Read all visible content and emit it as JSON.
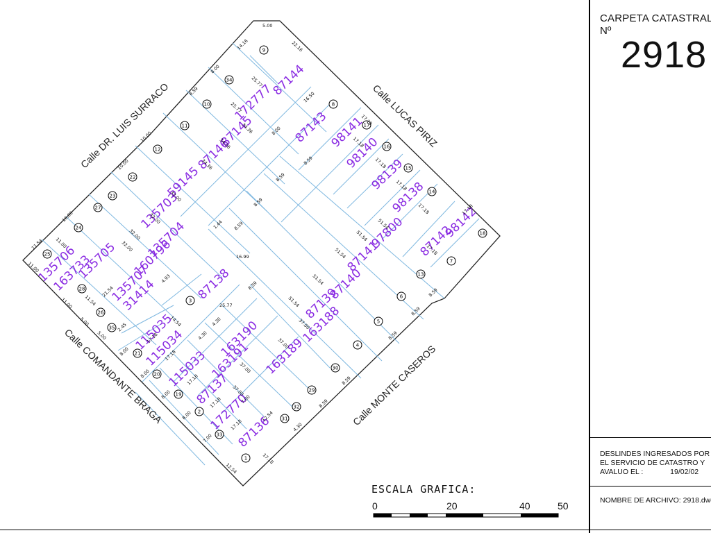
{
  "sidebar": {
    "carpeta_label": "CARPETA CATASTRAL",
    "no_label": "Nº",
    "carpeta_number": "2918",
    "deslindes_line1": "DESLINDES INGRESADOS POR",
    "deslindes_line2": "EL SERVICIO DE CATASTRO Y",
    "avaluo_label": "AVALUO EL :",
    "avaluo_date": "19/02/02",
    "archivo_label": "NOMBRE DE ARCHIVO: 2918.dwg"
  },
  "streets": {
    "north_west": "Calle DR. LUIS SURRACO",
    "north_east": "Calle LUCAS PIRIZ",
    "south_west": "Calle COMANDANTE BRAGA",
    "south_east": "Calle MONTE CASEROS"
  },
  "scale": {
    "title": "ESCALA GRAFICA:",
    "ticks": [
      "0",
      "20",
      "40",
      "50"
    ]
  },
  "parcels": [
    {
      "id": "87144",
      "lot": "9"
    },
    {
      "id": "172777",
      "lot": "34"
    },
    {
      "id": "87145",
      "lot": "10"
    },
    {
      "id": "87146",
      "lot": "11"
    },
    {
      "id": "59145",
      "lot": "12"
    },
    {
      "id": "135703",
      "lot": "22"
    },
    {
      "id": "135704",
      "lot": "23"
    },
    {
      "id": "160796",
      "lot": "27"
    },
    {
      "id": "135705",
      "lot": "24"
    },
    {
      "id": "135706",
      "lot": "25"
    },
    {
      "id": "163733",
      "lot": "28"
    },
    {
      "id": "135707",
      "lot": "26"
    },
    {
      "id": "31414",
      "lot": "35"
    },
    {
      "id": "87138",
      "lot": "3"
    },
    {
      "id": "87143",
      "lot": "8"
    },
    {
      "id": "98141",
      "lot": "17"
    },
    {
      "id": "98140",
      "lot": "16"
    },
    {
      "id": "98139",
      "lot": "15"
    },
    {
      "id": "98138",
      "lot": "14"
    },
    {
      "id": "97800",
      "lot": "13"
    },
    {
      "id": "98142",
      "lot": "18"
    },
    {
      "id": "87142",
      "lot": "7"
    },
    {
      "id": "87141",
      "lot": "6"
    },
    {
      "id": "87140",
      "lot": "5"
    },
    {
      "id": "87139",
      "lot": "4"
    },
    {
      "id": "163188",
      "lot": "30"
    },
    {
      "id": "163189",
      "lot": "29"
    },
    {
      "id": "163190",
      "lot": "32"
    },
    {
      "id": "163191",
      "lot": "31"
    },
    {
      "id": "115035",
      "lot": "21"
    },
    {
      "id": "115034",
      "lot": "20"
    },
    {
      "id": "115033",
      "lot": "19"
    },
    {
      "id": "87137",
      "lot": "2"
    },
    {
      "id": "172770",
      "lot": "33"
    },
    {
      "id": "87136",
      "lot": "1"
    }
  ],
  "dimensions": [
    "5.00",
    "22.16",
    "14.16",
    "8.00",
    "25.77",
    "8.59",
    "16.50",
    "34.36",
    "10.00",
    "32.00",
    "11.54",
    "11.00",
    "21.54",
    "17.18",
    "51.54",
    "37.00",
    "8.59",
    "4.30",
    "12.54",
    "1.44",
    "16.99",
    "14.54",
    "2.45",
    "4.93",
    "7.00",
    "8.00"
  ]
}
